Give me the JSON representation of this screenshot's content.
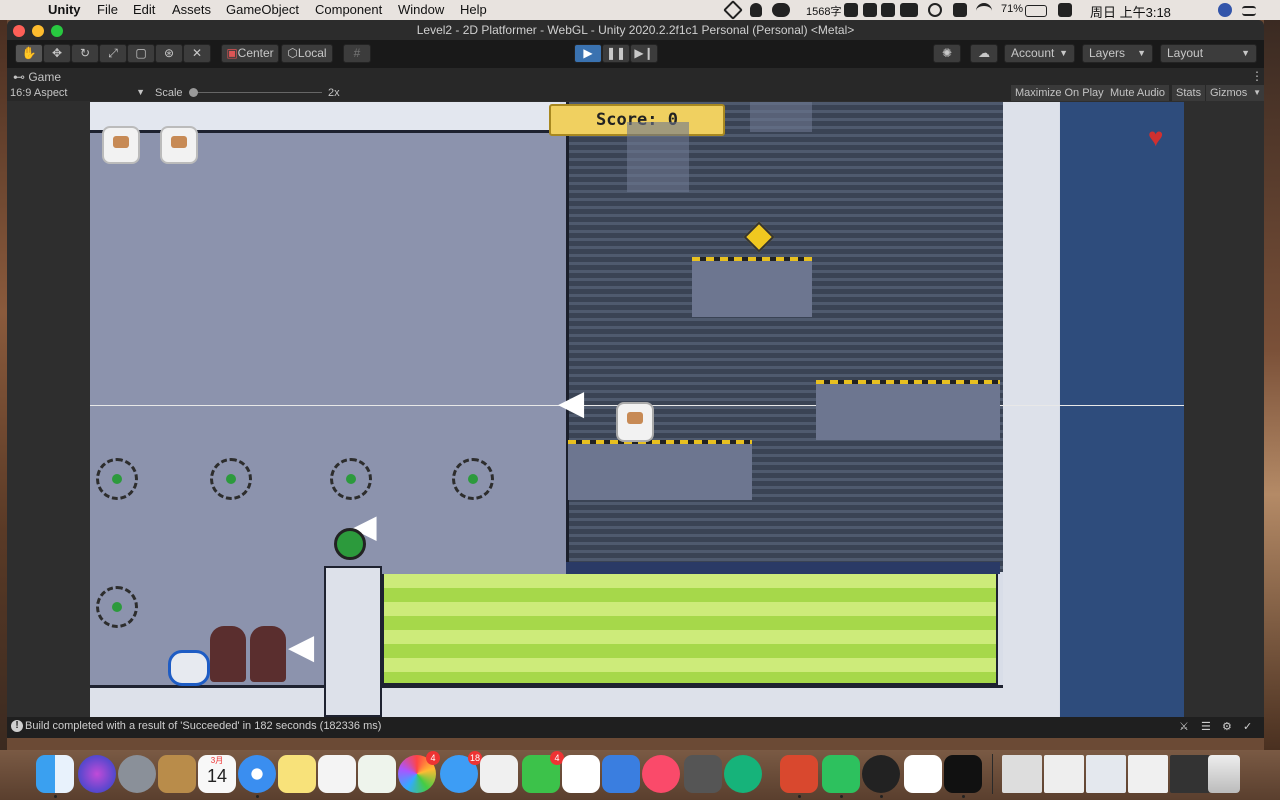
{
  "menubar": {
    "apple_glyph": "",
    "app_name": "Unity",
    "items": [
      "File",
      "Edit",
      "Assets",
      "GameObject",
      "Component",
      "Window",
      "Help"
    ],
    "word_count": "1568字",
    "battery": "71%",
    "clock": "周日 上午3:18"
  },
  "window": {
    "title": "Level2 - 2D Platformer - WebGL - Unity 2020.2.2f1c1 Personal (Personal) <Metal>"
  },
  "toolbar": {
    "tools": [
      "hand-icon",
      "move-icon",
      "rotate-icon",
      "scale-icon",
      "rect-icon",
      "transform-icon",
      "custom-tool-icon"
    ],
    "pivot_label": "Center",
    "space_label": "Local",
    "account_label": "Account",
    "layers_label": "Layers",
    "layout_label": "Layout"
  },
  "game_panel": {
    "tab_label": "Game",
    "aspect_label": "16:9 Aspect",
    "scale_label": "Scale",
    "scale_value": "2x",
    "buttons": [
      "Maximize On Play",
      "Mute Audio",
      "Stats",
      "Gizmos"
    ]
  },
  "game": {
    "score_label": "Score:",
    "score_value": "0",
    "lives": 2
  },
  "status": {
    "message": "Build completed with a result of 'Succeeded' in 182 seconds (182336 ms)"
  },
  "calendar": {
    "month": "3月",
    "day": "14"
  },
  "dock_badges": {
    "photos": "4",
    "messages": "18",
    "facetime": "4"
  },
  "colors": {
    "accent": "#3a72b0",
    "grass": "#b8e05a",
    "sky_right": "#2e4c7c",
    "score_plate": "#f0d060"
  }
}
